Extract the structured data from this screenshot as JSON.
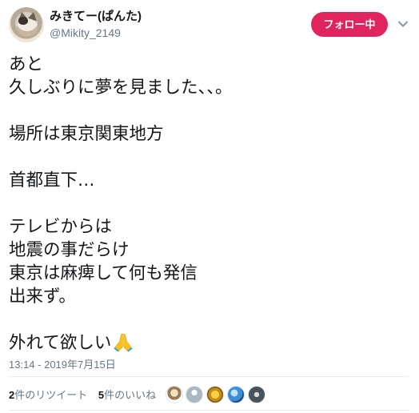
{
  "user": {
    "display_name": "みきてー(ぱんた)",
    "screen_name": "@Mikity_2149",
    "avatar_icon": "cat-avatar"
  },
  "follow_button": {
    "label": "フォロー中",
    "color": "#e0245e"
  },
  "menu": {
    "icon": "chevron-down-icon"
  },
  "tweet": {
    "lines": [
      "あと",
      "久しぶりに夢を見ました、、。",
      "",
      "場所は東京関東地方",
      "",
      "首都直下…",
      "",
      "テレビからは",
      "地震の事だらけ",
      "東京は麻痺して何も発信",
      "出来ず。",
      "",
      "外れて欲しい"
    ],
    "emoji": "folded-hands-icon"
  },
  "timestamp": "13:14 - 2019年7月15日",
  "stats": {
    "retweets_count": "2",
    "retweets_label": "件のリツイート",
    "likes_count": "5",
    "likes_label": "件のいいね"
  },
  "likers": [
    "liker-avatar-1",
    "liker-avatar-2",
    "liker-avatar-3",
    "liker-avatar-4",
    "liker-avatar-5"
  ]
}
